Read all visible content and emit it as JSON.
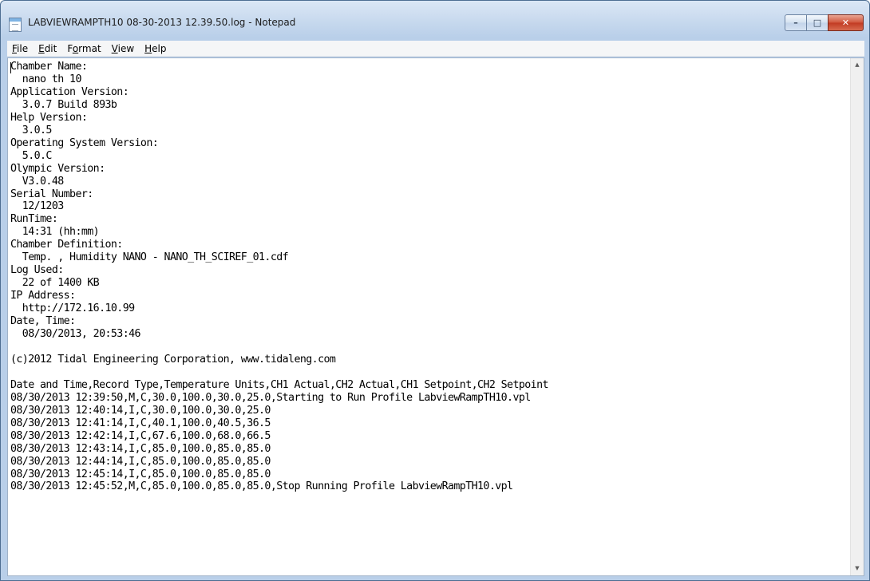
{
  "window": {
    "title": "LABVIEWRAMPTH10 08-30-2013 12.39.50.log - Notepad",
    "buttons": {
      "minimize": "–",
      "maximize": "□",
      "close": "✕"
    }
  },
  "menu": [
    {
      "pre": "",
      "acc": "F",
      "post": "ile"
    },
    {
      "pre": "",
      "acc": "E",
      "post": "dit"
    },
    {
      "pre": "F",
      "acc": "o",
      "post": "rmat"
    },
    {
      "pre": "",
      "acc": "V",
      "post": "iew"
    },
    {
      "pre": "",
      "acc": "H",
      "post": "elp"
    }
  ],
  "document": {
    "lines": [
      "Chamber Name:",
      "  nano th 10",
      "Application Version:",
      "  3.0.7 Build 893b",
      "Help Version:",
      "  3.0.5",
      "Operating System Version:",
      "  5.0.C",
      "Olympic Version:",
      "  V3.0.48",
      "Serial Number:",
      "  12/1203",
      "RunTime:",
      "  14:31 (hh:mm)",
      "Chamber Definition:",
      "  Temp. , Humidity NANO - NANO_TH_SCIREF_01.cdf",
      "Log Used:",
      "  22 of 1400 KB",
      "IP Address:",
      "  http://172.16.10.99",
      "Date, Time:",
      "  08/30/2013, 20:53:46",
      "",
      "(c)2012 Tidal Engineering Corporation, www.tidaleng.com",
      "",
      "Date and Time,Record Type,Temperature Units,CH1 Actual,CH2 Actual,CH1 Setpoint,CH2 Setpoint",
      "08/30/2013 12:39:50,M,C,30.0,100.0,30.0,25.0,Starting to Run Profile LabviewRampTH10.vpl",
      "08/30/2013 12:40:14,I,C,30.0,100.0,30.0,25.0",
      "08/30/2013 12:41:14,I,C,40.1,100.0,40.5,36.5",
      "08/30/2013 12:42:14,I,C,67.6,100.0,68.0,66.5",
      "08/30/2013 12:43:14,I,C,85.0,100.0,85.0,85.0",
      "08/30/2013 12:44:14,I,C,85.0,100.0,85.0,85.0",
      "08/30/2013 12:45:14,I,C,85.0,100.0,85.0,85.0",
      "08/30/2013 12:45:52,M,C,85.0,100.0,85.0,85.0,Stop Running Profile LabviewRampTH10.vpl"
    ]
  },
  "scrollbar": {
    "up": "▲",
    "down": "▼"
  }
}
